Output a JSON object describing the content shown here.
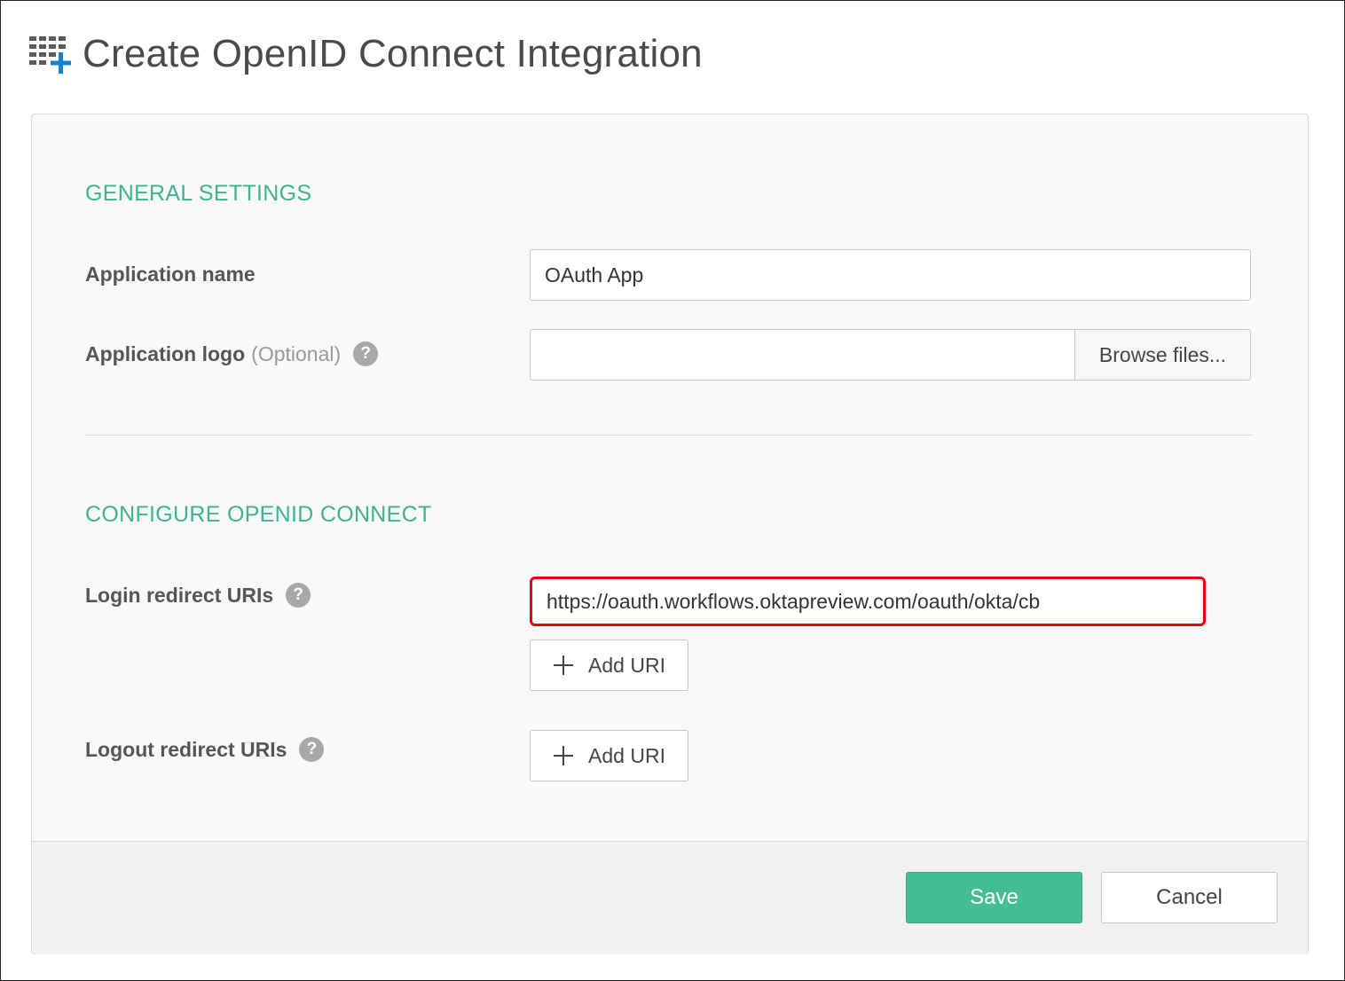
{
  "page": {
    "title": "Create OpenID Connect Integration",
    "icon": "grid-plus-icon"
  },
  "general": {
    "heading": "GENERAL SETTINGS",
    "app_name_label": "Application name",
    "app_name_value": "OAuth App",
    "app_logo_label": "Application logo",
    "app_logo_optional": "(Optional)",
    "browse_label": "Browse files..."
  },
  "oidc": {
    "heading": "CONFIGURE OPENID CONNECT",
    "login_label": "Login redirect URIs",
    "login_uri_value": "https://oauth.workflows.oktapreview.com/oauth/okta/cb",
    "logout_label": "Logout redirect URIs",
    "add_uri_label": "Add URI"
  },
  "help_glyph": "?",
  "footer": {
    "save_label": "Save",
    "cancel_label": "Cancel"
  },
  "colors": {
    "accent": "#3fb28f",
    "save_bg": "#45bd96",
    "highlight": "#e8000d"
  }
}
